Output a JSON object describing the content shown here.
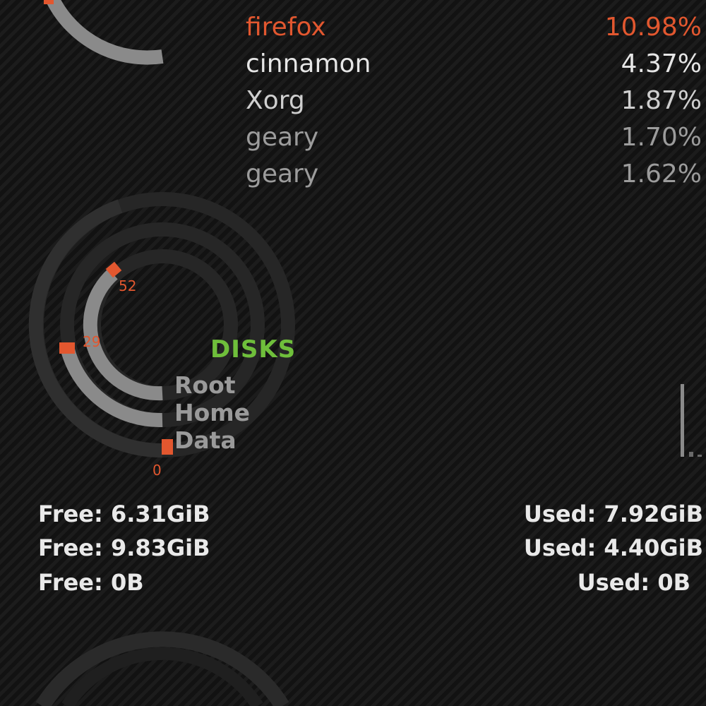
{
  "processes": [
    {
      "name": "firefox",
      "pct": "10.98%"
    },
    {
      "name": "cinnamon",
      "pct": "4.37%"
    },
    {
      "name": "Xorg",
      "pct": "1.87%"
    },
    {
      "name": "geary",
      "pct": "1.70%"
    },
    {
      "name": "geary",
      "pct": "1.62%"
    }
  ],
  "disks": {
    "title": "DISKS",
    "labels": [
      "Root",
      "Home",
      "Data"
    ],
    "ticks": [
      "52",
      "29",
      "0"
    ],
    "free": [
      "Free: 6.31GiB",
      "Free: 9.83GiB",
      "Free: 0B"
    ],
    "used": [
      "Used: 7.92GiB",
      "Used: 4.40GiB",
      "Used: 0B"
    ]
  },
  "colors": {
    "accent": "#e2572f",
    "title_green": "#6fbf3b",
    "ring_gray": "#8a8a8a",
    "ring_track": "#262626"
  }
}
